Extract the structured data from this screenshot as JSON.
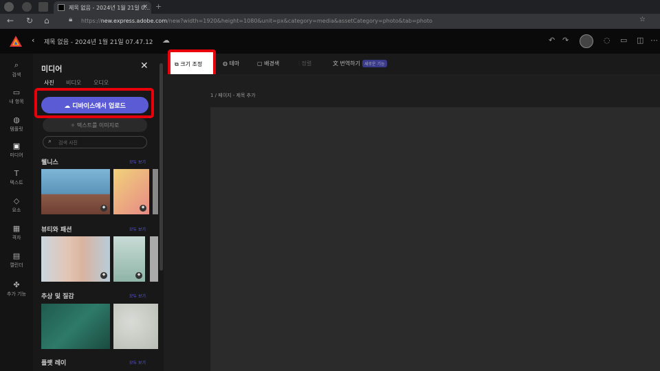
{
  "browser": {
    "tab_title": "제목 없음 - 2024년 1월 21일 0...",
    "tab_close": "×",
    "new_tab": "+",
    "url_prefix": "https://",
    "url_domain": "new.express.adobe.com",
    "url_rest": "/new?width=1920&height=1080&unit=px&category=media&assetCategory=photo&tab=photo"
  },
  "app": {
    "back_glyph": "‹",
    "document_title": "제목 없음 - 2024년 1월 21일 07.47.12",
    "cloud_glyph": "☁"
  },
  "rail": {
    "items": [
      {
        "icon": "search-icon",
        "glyph": "⌕",
        "label": "검색"
      },
      {
        "icon": "folder-icon",
        "glyph": "▭",
        "label": "내 항목"
      },
      {
        "icon": "template-icon",
        "glyph": "◍",
        "label": "템플릿"
      },
      {
        "icon": "media-icon",
        "glyph": "▣",
        "label": "미디어"
      },
      {
        "icon": "text-icon",
        "glyph": "T",
        "label": "텍스트"
      },
      {
        "icon": "elements-icon",
        "glyph": "◇",
        "label": "요소"
      },
      {
        "icon": "grid-icon",
        "glyph": "▦",
        "label": "격자"
      },
      {
        "icon": "calendar-icon",
        "glyph": "▤",
        "label": "캘린더"
      },
      {
        "icon": "plugin-icon",
        "glyph": "✤",
        "label": "추가 기능"
      }
    ]
  },
  "panel": {
    "title": "미디어",
    "close_glyph": "✕",
    "tabs": [
      "사진",
      "비디오",
      "오디오"
    ],
    "upload_label": "디바이스에서 업로드",
    "text_to_image_label": "텍스트를 이미지로",
    "search_placeholder": "검색 사진",
    "more_label": "모두 보기",
    "sections": [
      "웰니스",
      "뷰티와 패션",
      "추상 및 질감",
      "플랫 레이"
    ]
  },
  "toolbar": {
    "resize_label": "크기 조정",
    "theme_label": "테마",
    "background_label": "배경색",
    "layout_label": "정렬",
    "translate_label": "번역하기",
    "translate_badge": "새로운 기능"
  },
  "canvas": {
    "page_label": "1 / 페이지 - 제목 추가"
  },
  "colors": {
    "accent": "#5b5bd6",
    "highlight": "#e8000b"
  }
}
